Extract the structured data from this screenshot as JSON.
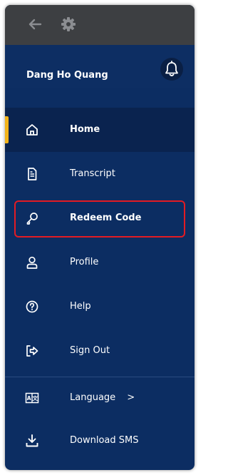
{
  "user": {
    "name": "Dang Ho Quang"
  },
  "icons": {
    "back": "arrow-left-icon",
    "settings": "gear-icon",
    "notifications": "bell-icon"
  },
  "colors": {
    "topbar": "#3d3f42",
    "navy": "#0c2d62",
    "accent": "#f2b319",
    "highlight": "#e31b23"
  },
  "menu": {
    "items": [
      {
        "label": "Home",
        "icon": "home-icon"
      },
      {
        "label": "Transcript",
        "icon": "document-icon"
      },
      {
        "label": "Redeem Code",
        "icon": "key-icon"
      },
      {
        "label": "Profile",
        "icon": "user-icon"
      },
      {
        "label": "Help",
        "icon": "help-circle-icon"
      },
      {
        "label": "Sign Out",
        "icon": "sign-out-icon"
      },
      {
        "label": "Language",
        "icon": "language-icon",
        "chevron": ">"
      },
      {
        "label": "Download SMS",
        "icon": "download-icon"
      }
    ]
  }
}
